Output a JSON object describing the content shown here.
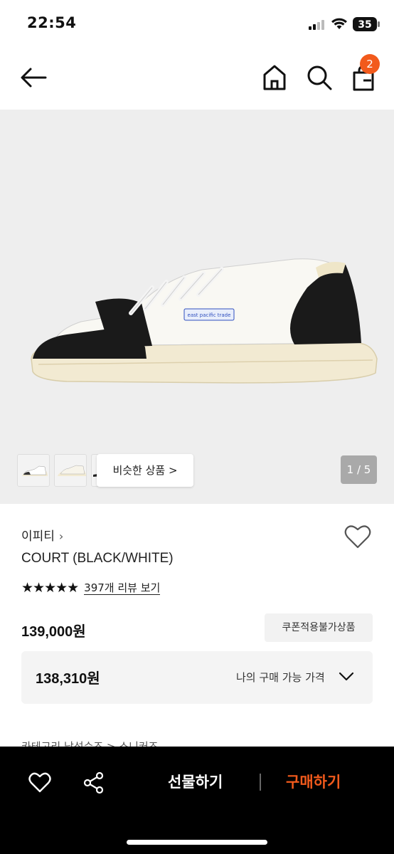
{
  "status_bar": {
    "time": "22:54",
    "battery": "35"
  },
  "nav": {
    "cart_count": "2"
  },
  "gallery": {
    "similar_label": "비슷한 상품 >",
    "counter": "1 / 5",
    "shoe_label": "east pacific trade"
  },
  "product": {
    "brand": "이피티",
    "brand_chevron": "›",
    "name": "COURT (BLACK/WHITE)",
    "stars": "★★★★★",
    "review_link": "397개 리뷰 보기",
    "price": "139,000원",
    "coupon_badge": "쿠폰적용불가상품",
    "my_price": "138,310원",
    "my_price_label": "나의 구매 가능 가격",
    "category_path": "카테고리     남성슈즈 > 스니커즈"
  },
  "bottom_bar": {
    "gift_label": "선물하기",
    "buy_label": "구매하기"
  },
  "colors": {
    "accent": "#f25a1c",
    "hero_bg": "#eeeeee",
    "bottom_bg": "#000000"
  }
}
